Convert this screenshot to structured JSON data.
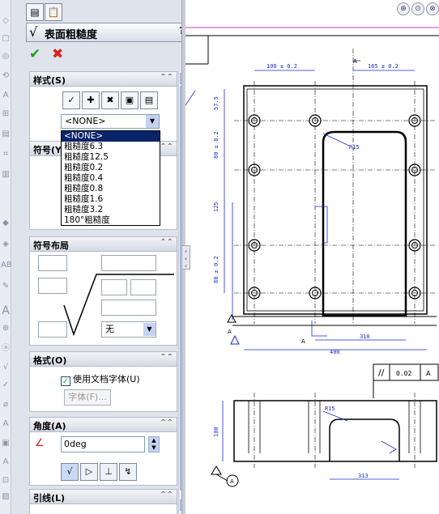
{
  "panel": {
    "title": "表面粗糙度",
    "help": "?",
    "groups": {
      "style": {
        "title": "样式(S)"
      },
      "symbol": {
        "title": "符号(Y)"
      },
      "layout": {
        "title": "符号布局"
      },
      "format": {
        "title": "格式(O)",
        "use_doc_font": "使用文档字体(U)",
        "font_button": "字体(F)..."
      },
      "angle": {
        "title": "角度(A)",
        "value": "0deg"
      },
      "leader": {
        "title": "引线(L)"
      }
    },
    "style_select": {
      "value": "<NONE>"
    },
    "style_options": [
      "<NONE>",
      "粗糙度6.3",
      "粗糙度12.5",
      "粗糙度0.2",
      "粗糙度0.4",
      "粗糙度0.8",
      "粗糙度1.6",
      "粗糙度3.2",
      "180°粗糙度"
    ],
    "layout_select": {
      "value": "无"
    }
  },
  "drawing": {
    "dims": {
      "top_left": "100 ± 0.2",
      "top_right": "165 ± 0.2",
      "left_1": "57.5",
      "left_2": "80 ± 0.2",
      "left_3": "125",
      "left_4": "80 ± 0.2",
      "radius": "R15",
      "bottom_1": "310",
      "bottom_2": "400",
      "section_height": "100",
      "section_radius": "R15",
      "section_width": "313",
      "flatness": "0.02",
      "flatness_ref": "A"
    },
    "datum_letters": [
      "A",
      "A",
      "A",
      "A"
    ]
  }
}
